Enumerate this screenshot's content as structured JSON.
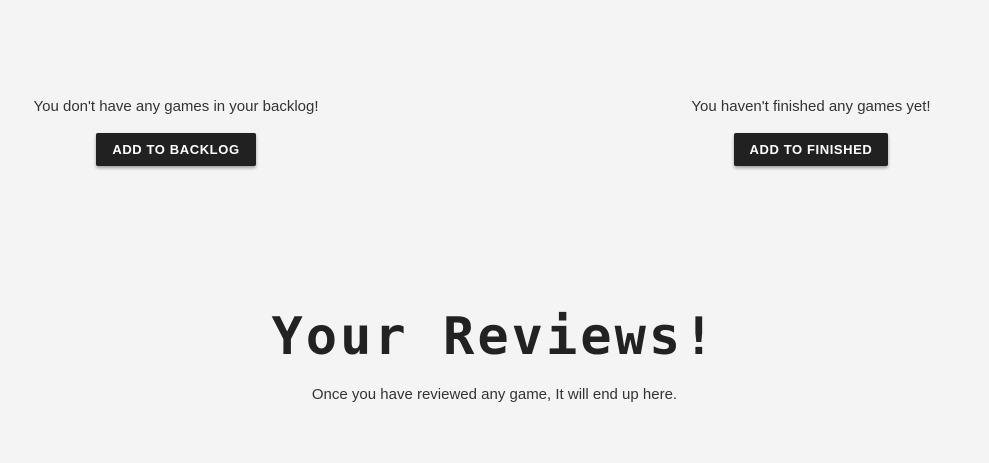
{
  "backlog": {
    "empty_message": "You don't have any games in your backlog!",
    "button_label": "ADD TO BACKLOG"
  },
  "finished": {
    "empty_message": "You haven't finished any games yet!",
    "button_label": "ADD TO FINISHED"
  },
  "reviews": {
    "title": "Your Reviews!",
    "empty_message": "Once you have reviewed any game, It will end up here."
  },
  "colors": {
    "background": "#f4f4f4",
    "button_bg": "#212121",
    "button_text": "#ffffff",
    "text": "#333333"
  }
}
